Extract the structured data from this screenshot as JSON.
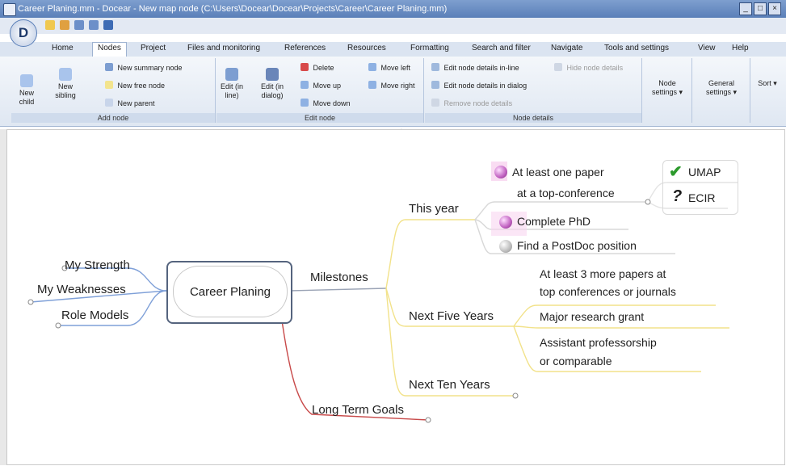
{
  "window": {
    "title": "Career Planing.mm - Docear - New map node (C:\\Users\\Docear\\Docear\\Projects\\Career\\Career Planing.mm)"
  },
  "ribbon": {
    "tabs": [
      "Home",
      "Nodes",
      "Project",
      "Files and monitoring",
      "References",
      "Resources",
      "Formatting",
      "Search and filter",
      "Navigate",
      "Tools and settings",
      "View",
      "Help"
    ],
    "active_tab": "Nodes",
    "groups": {
      "add_node": {
        "label": "Add node",
        "new_child": "New child",
        "new_sibling": "New sibling",
        "new_summary_node": "New summary node",
        "new_free_node": "New free node",
        "new_parent": "New parent"
      },
      "edit_node": {
        "label": "Edit node",
        "edit_inline": "Edit (in line)",
        "edit_dialog": "Edit (in dialog)",
        "delete": "Delete",
        "move_up": "Move up",
        "move_down": "Move down",
        "move_left": "Move left",
        "move_right": "Move right"
      },
      "node_details": {
        "label": "Node details",
        "edit_details_inline": "Edit node details in-line",
        "edit_details_dialog": "Edit node details in dialog",
        "remove_details": "Remove node details",
        "hide_details": "Hide node details"
      },
      "node_settings": "Node settings",
      "general_settings": "General settings",
      "sort": "Sort"
    }
  },
  "mindmap": {
    "central": "Career Planing",
    "left": [
      "My Strength",
      "My Weaknesses",
      "Role Models"
    ],
    "milestones": "Milestones",
    "long_term_goals": "Long Term Goals",
    "this_year": {
      "label": "This year",
      "paper_line1": "At least one paper",
      "paper_line2": "at a top-conference",
      "umap": "UMAP",
      "ecir": "ECIR",
      "phd": "Complete PhD",
      "postdoc": "Find a PostDoc position"
    },
    "next_five": {
      "label": "Next Five Years",
      "papers_line1": "At least 3 more papers at",
      "papers_line2": "top conferences or journals",
      "grant": "Major research grant",
      "prof_line1": "Assistant professorship",
      "prof_line2": "or comparable"
    },
    "next_ten": "Next Ten Years"
  },
  "icons": {
    "check": "✔",
    "question": "?",
    "orb": "D"
  },
  "colors": {
    "branch_blue": "#7fa0d8",
    "branch_red": "#c84a4a",
    "branch_yellow": "#f2e28a",
    "central_border": "#55647e"
  }
}
